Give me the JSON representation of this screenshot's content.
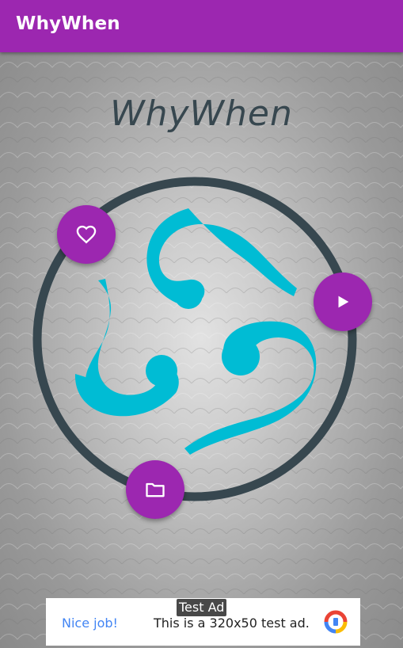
{
  "appbar": {
    "title": "WhyWhen"
  },
  "main": {
    "logo_text": "WhyWhen"
  },
  "buttons": {
    "favorite": {
      "icon": "heart-outline-icon"
    },
    "play": {
      "icon": "play-icon"
    },
    "folder": {
      "icon": "folder-icon"
    }
  },
  "ad": {
    "badge": "Test Ad",
    "left_text": "Nice job!",
    "center_text": "This is a 320x50 test ad.",
    "logo_icon": "ad-provider-logo-icon"
  },
  "colors": {
    "primary": "#9c27b0",
    "accent_cyan": "#00bcd4",
    "ring": "#37474f"
  }
}
